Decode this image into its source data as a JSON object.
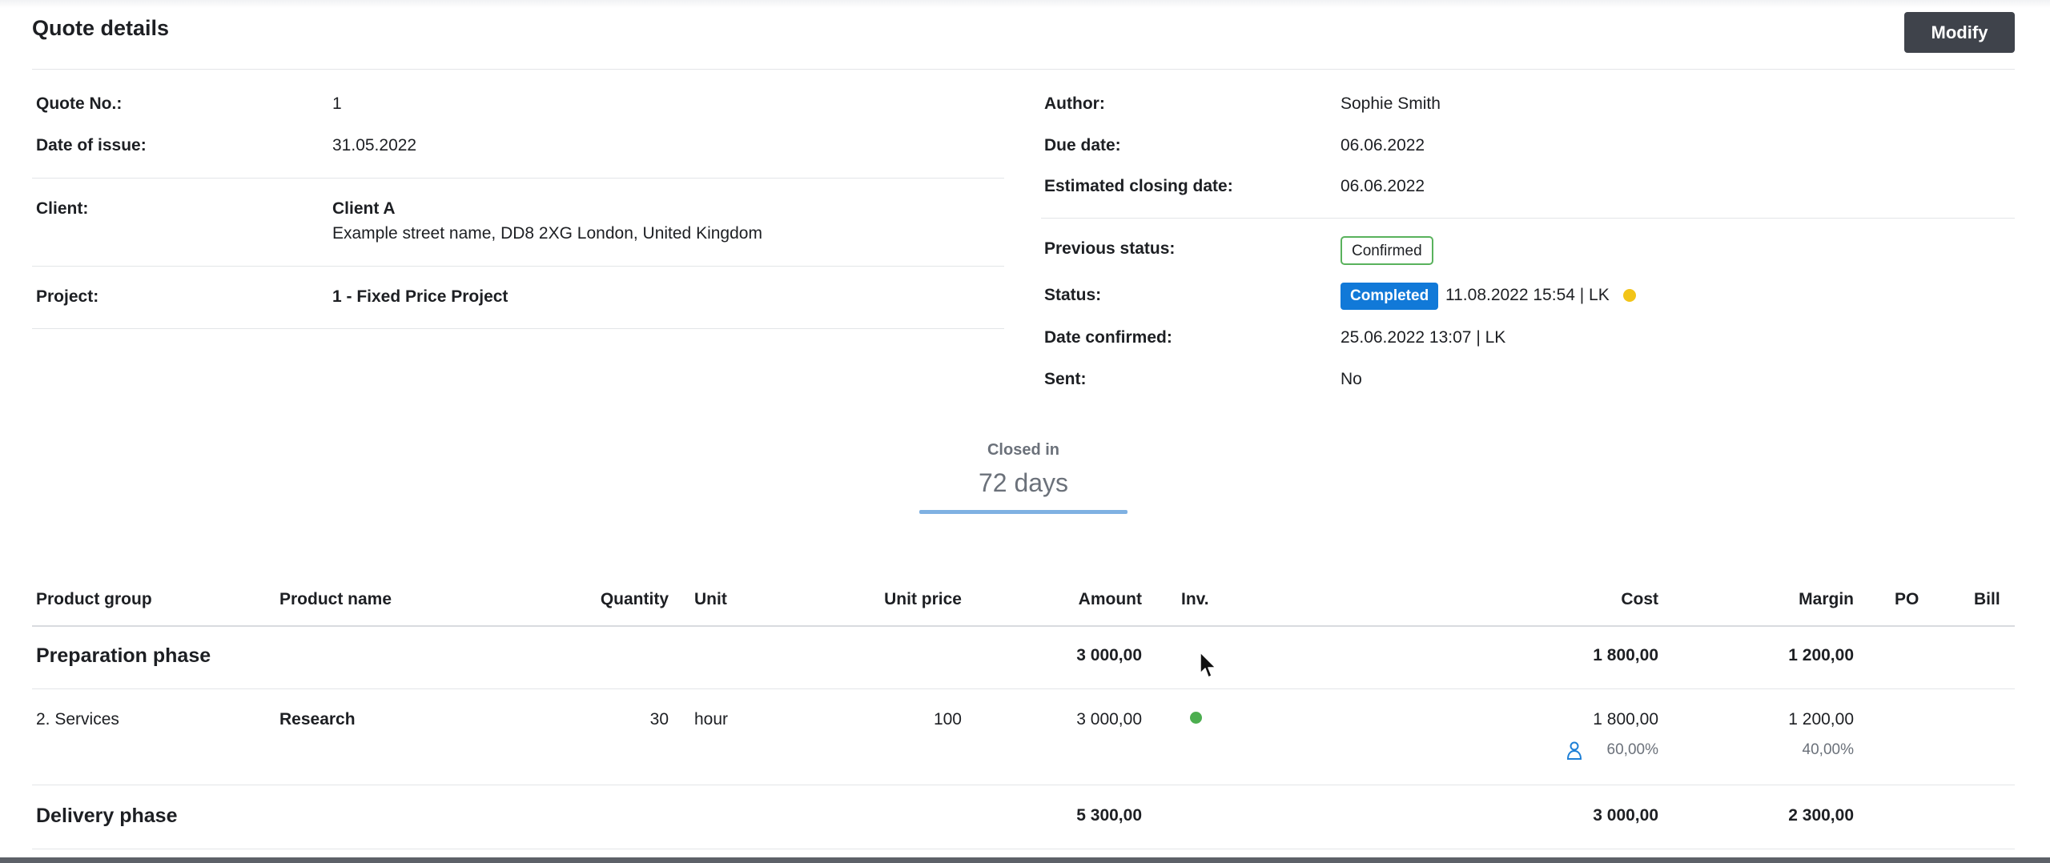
{
  "header": {
    "title": "Quote details",
    "modify_label": "Modify"
  },
  "left_details": {
    "quote_no_label": "Quote No.:",
    "quote_no": "1",
    "date_of_issue_label": "Date of issue:",
    "date_of_issue": "31.05.2022",
    "client_label": "Client:",
    "client_name": "Client A",
    "client_address": "Example street name, DD8 2XG London, United Kingdom",
    "project_label": "Project:",
    "project": "1 - Fixed Price Project"
  },
  "right_details": {
    "author_label": "Author:",
    "author": "Sophie Smith",
    "due_date_label": "Due date:",
    "due_date": "06.06.2022",
    "closing_label": "Estimated closing date:",
    "closing_date": "06.06.2022",
    "prev_status_label": "Previous status:",
    "prev_status": "Confirmed",
    "status_label": "Status:",
    "status": "Completed",
    "status_meta": "11.08.2022 15:54 | LK",
    "date_confirmed_label": "Date confirmed:",
    "date_confirmed": "25.06.2022 13:07 | LK",
    "sent_label": "Sent:",
    "sent": "No"
  },
  "closed": {
    "label": "Closed in",
    "value": "72 days"
  },
  "table": {
    "headers": {
      "product_group": "Product group",
      "product_name": "Product name",
      "quantity": "Quantity",
      "unit": "Unit",
      "unit_price": "Unit price",
      "amount": "Amount",
      "inv": "Inv.",
      "cost": "Cost",
      "margin": "Margin",
      "po": "PO",
      "bill": "Bill"
    },
    "groups": [
      {
        "name": "Preparation phase",
        "amount": "3 000,00",
        "cost": "1 800,00",
        "margin": "1 200,00"
      },
      {
        "name": "Delivery phase",
        "amount": "5 300,00",
        "cost": "3 000,00",
        "margin": "2 300,00"
      }
    ],
    "rows": [
      {
        "product_group": "2. Services",
        "product_name": "Research",
        "quantity": "30",
        "unit": "hour",
        "unit_price": "100",
        "amount": "3 000,00",
        "cost": "1 800,00",
        "cost_pct": "60,00%",
        "margin": "1 200,00",
        "margin_pct": "40,00%"
      }
    ]
  },
  "colors": {
    "primary_button": "#3f434b",
    "status_completed": "#1179d8",
    "confirmed_border": "#59b25c",
    "status_dot": "#f2c418",
    "invoice_dot": "#4cae4f",
    "closed_bar": "#7fb1e2"
  },
  "icons": {
    "person": "person-icon",
    "cursor": "mouse-cursor-icon"
  }
}
